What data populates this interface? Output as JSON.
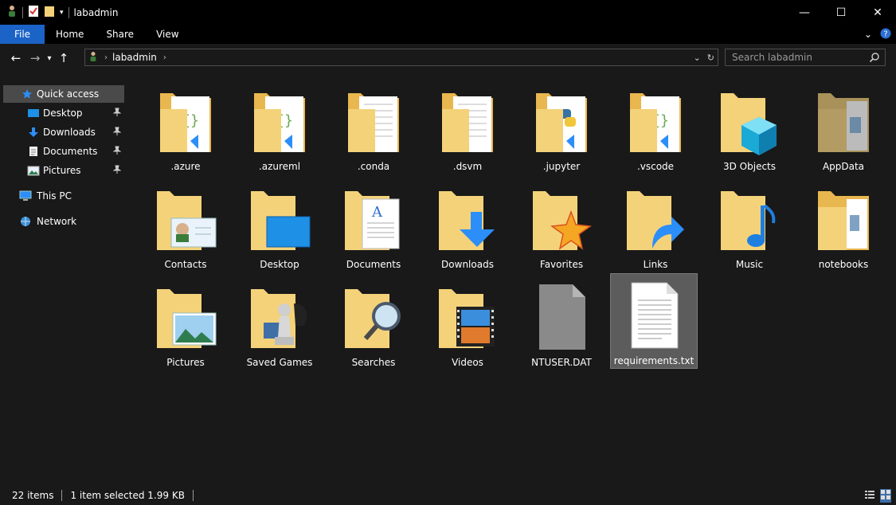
{
  "window": {
    "title": "labadmin",
    "minimize": "—",
    "maximize": "☐",
    "close": "✕"
  },
  "ribbon": {
    "tabs": [
      "File",
      "Home",
      "Share",
      "View"
    ]
  },
  "address": {
    "crumbs": [
      "labadmin"
    ],
    "search_placeholder": "Search labadmin"
  },
  "nav": {
    "quick_access": "Quick access",
    "desktop": "Desktop",
    "downloads": "Downloads",
    "documents": "Documents",
    "pictures": "Pictures",
    "this_pc": "This PC",
    "network": "Network"
  },
  "items": [
    {
      "label": ".azure",
      "icon": "folder-vscode-icon"
    },
    {
      "label": ".azureml",
      "icon": "folder-vscode-icon"
    },
    {
      "label": ".conda",
      "icon": "folder-document-icon"
    },
    {
      "label": ".dsvm",
      "icon": "folder-document-icon"
    },
    {
      "label": ".jupyter",
      "icon": "folder-python-icon"
    },
    {
      "label": ".vscode",
      "icon": "folder-vscode-icon"
    },
    {
      "label": "3D Objects",
      "icon": "folder-3d-icon"
    },
    {
      "label": "AppData",
      "icon": "folder-hidden-icon"
    },
    {
      "label": "Contacts",
      "icon": "folder-contacts-icon"
    },
    {
      "label": "Desktop",
      "icon": "folder-desktop-icon"
    },
    {
      "label": "Documents",
      "icon": "folder-documents-icon"
    },
    {
      "label": "Downloads",
      "icon": "folder-downloads-icon"
    },
    {
      "label": "Favorites",
      "icon": "folder-favorites-icon"
    },
    {
      "label": "Links",
      "icon": "folder-links-icon"
    },
    {
      "label": "Music",
      "icon": "folder-music-icon"
    },
    {
      "label": "notebooks",
      "icon": "folder-document-icon"
    },
    {
      "label": "Pictures",
      "icon": "folder-pictures-icon"
    },
    {
      "label": "Saved Games",
      "icon": "folder-games-icon"
    },
    {
      "label": "Searches",
      "icon": "folder-search-icon"
    },
    {
      "label": "Videos",
      "icon": "folder-videos-icon"
    },
    {
      "label": "NTUSER.DAT",
      "icon": "blank-file-icon"
    },
    {
      "label": "requirements.txt",
      "icon": "text-file-icon",
      "selected": true
    }
  ],
  "status": {
    "count": "22 items",
    "selection": "1 item selected  1.99 KB"
  },
  "colors": {
    "accent": "#1b63c6",
    "folder": "#f4d27a",
    "background": "#191919"
  }
}
